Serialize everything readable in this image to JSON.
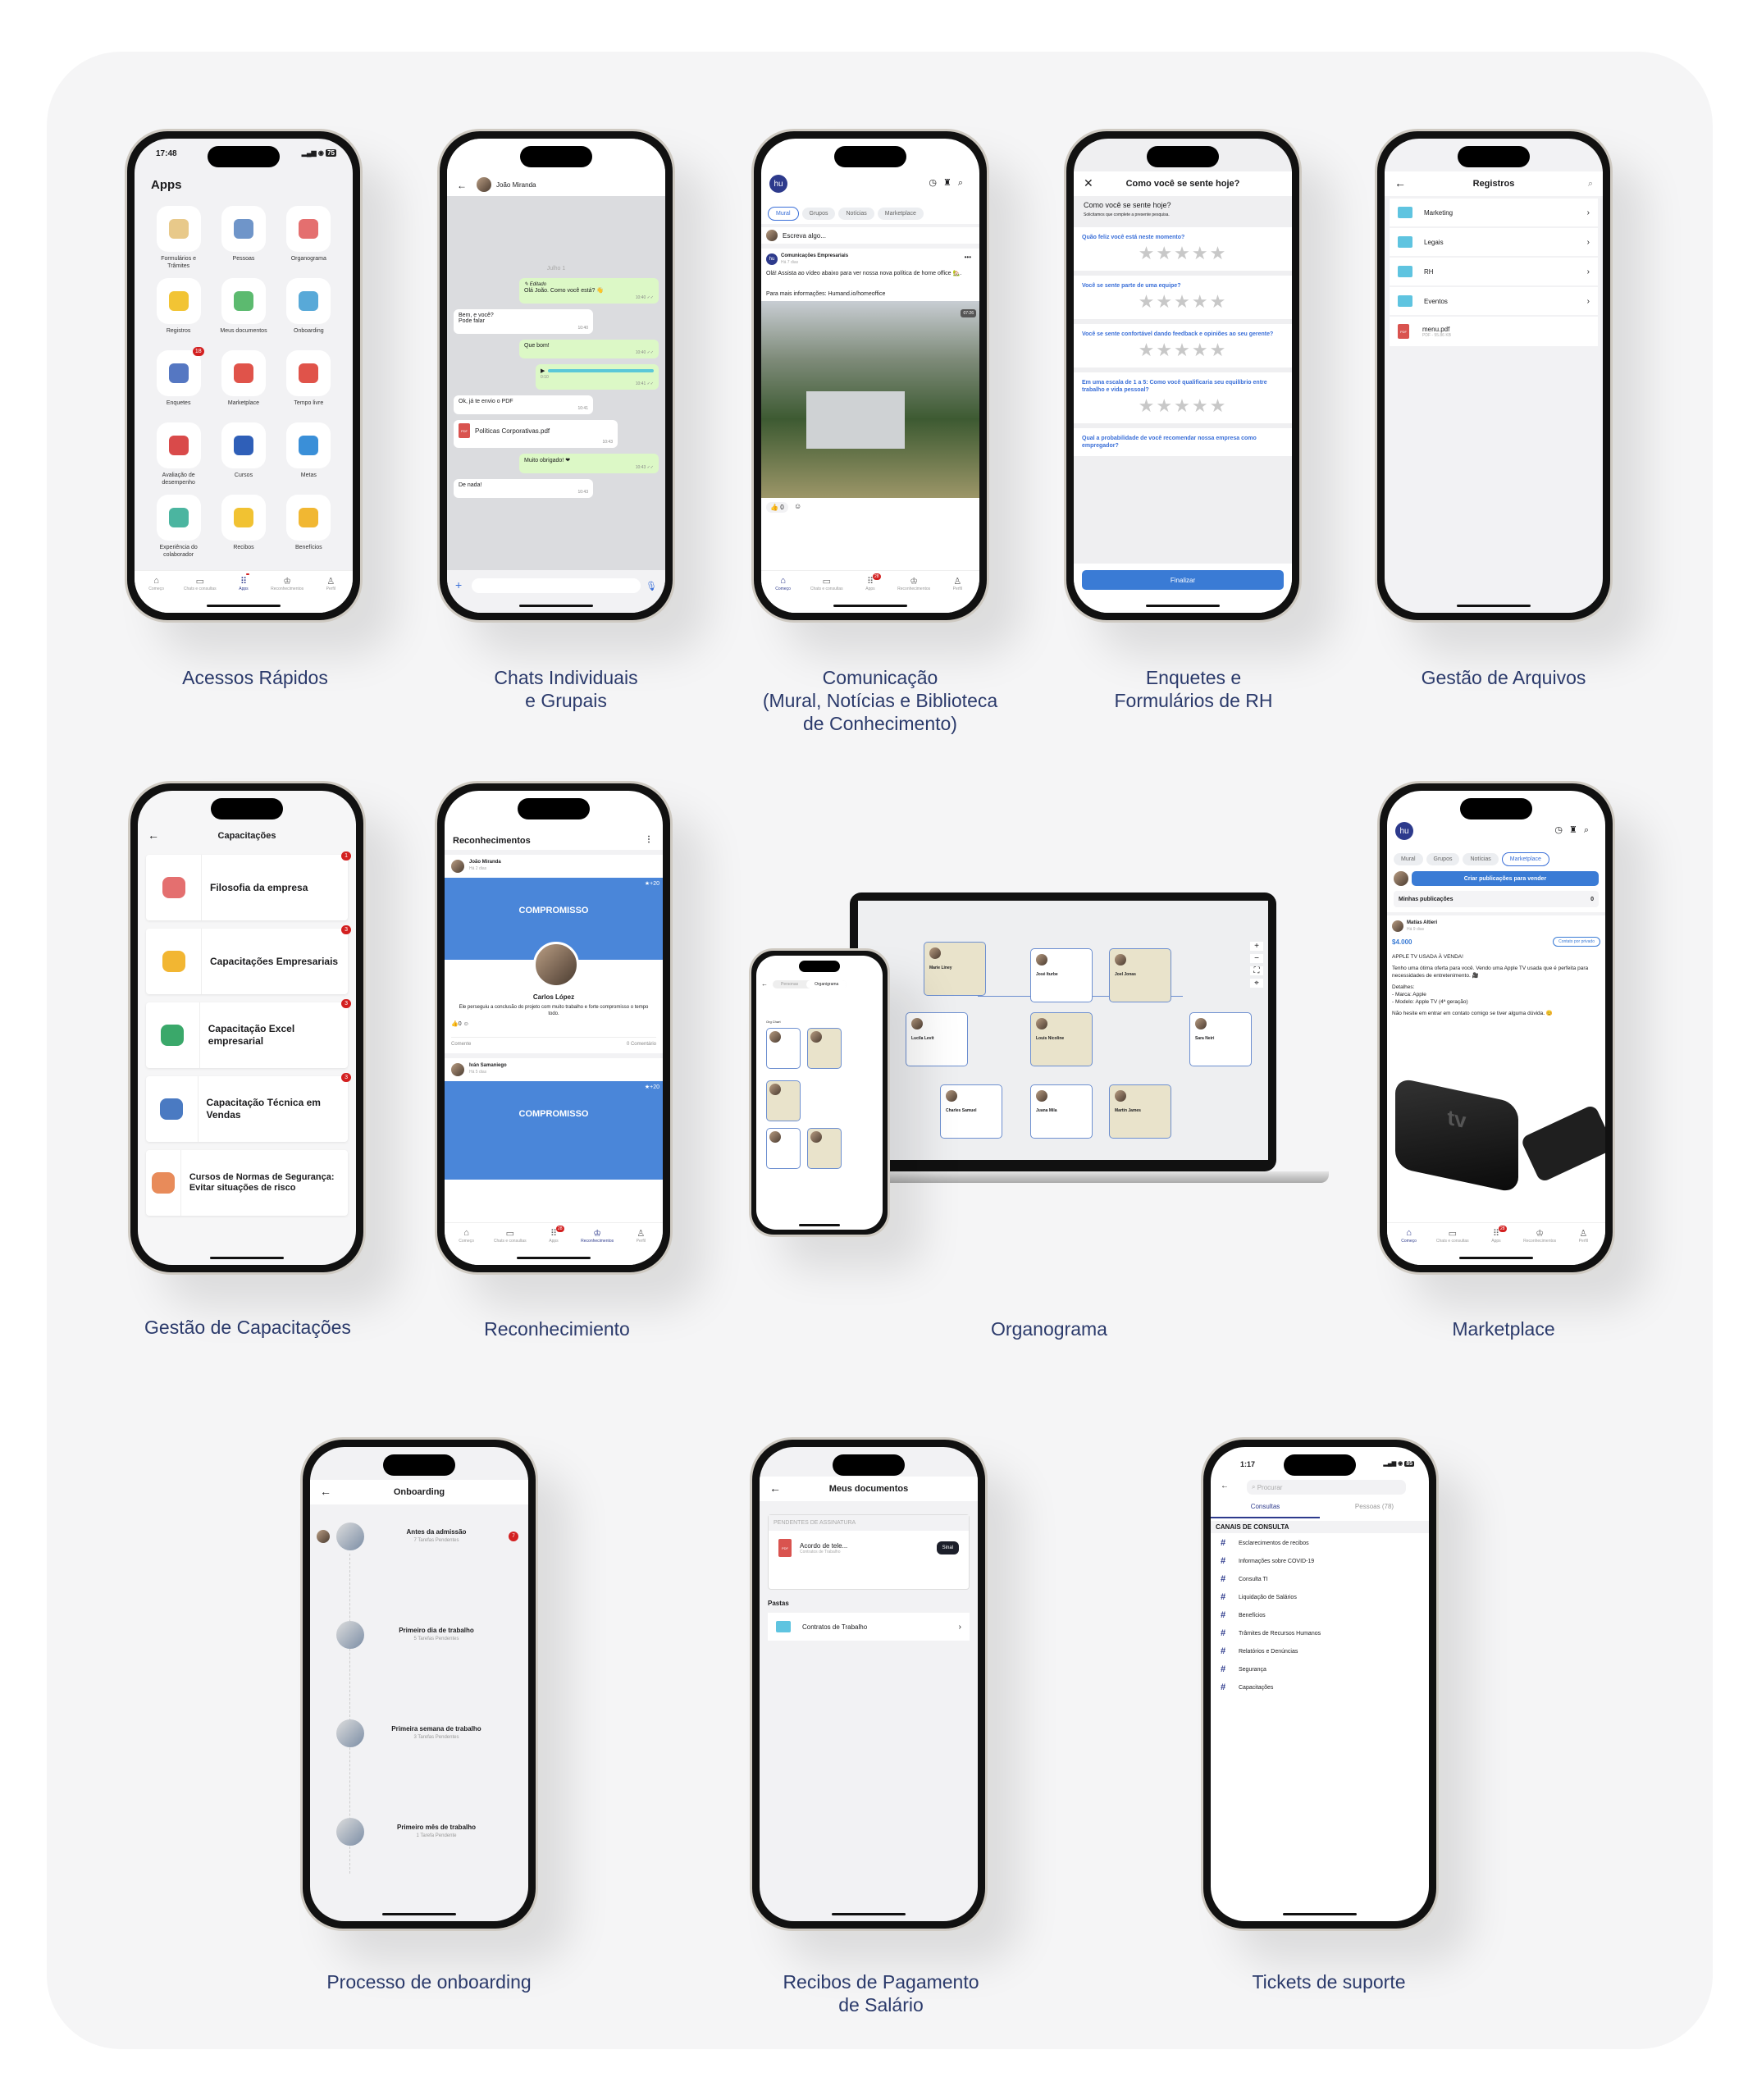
{
  "colors": {
    "accent": "#3a6fd8",
    "brand": "#2d3a8c",
    "caption": "#2b3a6b",
    "badge": "#d32020"
  },
  "nav": {
    "items": [
      "Começo",
      "Chats e consultas",
      "Apps",
      "Reconhecimentos",
      "Perfil"
    ],
    "badge_apps_phone1": "18",
    "badge": "28"
  },
  "captions": {
    "apps": "Acessos Rápidos",
    "chats": "Chats Individuais\ne Grupais",
    "mural": "Comunicação\n(Mural, Notícias e Biblioteca\nde Conhecimento)",
    "survey": "Enquetes e\nFormulários de RH",
    "files": "Gestão de Arquivos",
    "training": "Gestão de Capacitações",
    "recog": "Reconhecimiento",
    "org": "Organograma",
    "market": "Marketplace",
    "onboarding": "Processo de onboarding",
    "payslip": "Recibos de Pagamento\nde Salário",
    "tickets": "Tickets de suporte"
  },
  "apps": {
    "time": "17:48",
    "battery": "75",
    "title": "Apps",
    "tiles": [
      {
        "label": "Formulários e Trâmites",
        "color": "#e8c98a"
      },
      {
        "label": "Pessoas",
        "color": "#6f95c9"
      },
      {
        "label": "Organograma",
        "color": "#e46f6f"
      },
      {
        "label": "Registros",
        "color": "#f2c434"
      },
      {
        "label": "Meus documentos",
        "color": "#5cba6f"
      },
      {
        "label": "Onboarding",
        "color": "#58a9d8"
      },
      {
        "label": "Enquetes",
        "color": "#5577c2",
        "badge": "18"
      },
      {
        "label": "Marketplace",
        "color": "#e0534a"
      },
      {
        "label": "Tempo livre",
        "color": "#e0534a"
      },
      {
        "label": "Avaliação de desempenho",
        "color": "#d94a4a"
      },
      {
        "label": "Cursos",
        "color": "#2f5fb8"
      },
      {
        "label": "Metas",
        "color": "#3a8fd8"
      },
      {
        "label": "Experiência do colaborador",
        "color": "#4bb5a0"
      },
      {
        "label": "Recibos",
        "color": "#f1c232"
      },
      {
        "label": "Benefícios",
        "color": "#f1b732"
      }
    ]
  },
  "chat": {
    "contact": "João Miranda",
    "date": "Julho 1",
    "messages": [
      {
        "dir": "out",
        "edited": "✎ Editado",
        "text": "Olá João. Como você está? 👋",
        "time": "10:40 ✓✓"
      },
      {
        "dir": "in",
        "text": "Bem, e você?\nPode falar",
        "time": "10:40"
      },
      {
        "dir": "out",
        "text": "Que bom!",
        "time": "10:40 ✓✓"
      },
      {
        "dir": "out",
        "audio": "0:10",
        "time": "10:41 ✓✓"
      },
      {
        "dir": "in",
        "text": "Ok, já te envio o PDF",
        "time": "10:41"
      },
      {
        "dir": "in",
        "file": "Políticas Corporativas.pdf",
        "time": "10:43"
      },
      {
        "dir": "out",
        "text": "Muito obrigado! ❤",
        "time": "10:43 ✓✓"
      },
      {
        "dir": "in",
        "text": "De nada!",
        "time": "10:43"
      }
    ]
  },
  "mural": {
    "logo": "hu",
    "tabs": [
      "Mural",
      "Grupos",
      "Notícias",
      "Marketplace"
    ],
    "compose_placeholder": "Escreva algo...",
    "post": {
      "author": "Comunicações Empresariais",
      "ago": "Há 7 dias",
      "text": "Olá! Assista ao vídeo abaixo para ver nossa nova política de home office 🏡.",
      "link": "Para mais informações: Humand.io/homeoffice",
      "duration": "07:26",
      "likes": "0"
    }
  },
  "survey": {
    "title": "Como você se sente hoje?",
    "heading": "Como você se sente hoje?",
    "subtitle": "Solicitamos que complete a presente pesquisa.",
    "questions": [
      "Quão feliz você está neste momento?",
      "Você se sente parte de uma equipe?",
      "Você se sente confortável dando feedback e opiniões ao seu gerente?",
      "Em uma escala de 1 a 5: Como você qualificaria seu equilíbrio entre trabalho e vida pessoal?",
      "Qual a probabilidade de você recomendar nossa empresa como empregador?"
    ],
    "rating_max": 5,
    "submit": "Finalizar"
  },
  "files": {
    "title": "Registros",
    "folders": [
      "Marketing",
      "Legais",
      "RH",
      "Eventos"
    ],
    "file": {
      "name": "menu.pdf",
      "meta": "PDF - 55.86 KB",
      "type": "PDF"
    }
  },
  "training": {
    "title": "Capacitações",
    "items": [
      {
        "label": "Filosofia da empresa",
        "badge": "1",
        "color": "#e46f6f"
      },
      {
        "label": "Capacitações Empresariais",
        "badge": "3",
        "color": "#f2b632"
      },
      {
        "label": "Capacitação Excel empresarial",
        "badge": "3",
        "color": "#3aa86a"
      },
      {
        "label": "Capacitação Técnica em Vendas",
        "badge": "3",
        "color": "#4a7ac2"
      },
      {
        "label": "Cursos de Normas de Segurança: Evitar situações de risco",
        "color": "#e88b5a"
      }
    ]
  },
  "recog": {
    "title": "Reconhecimentos",
    "posts": [
      {
        "author": "João Miranda",
        "ago": "Há 2 dias",
        "points": "★+20",
        "value": "COMPROMISSO",
        "person": "Carlos López",
        "text": "Ele perseguiu a conclusão do projeto com muito trabalho e forte compromisso o tempo todo.",
        "likes": "0",
        "comment": "Comente",
        "comments": "0 Comentário"
      },
      {
        "author": "Iván Samaniego",
        "ago": "Há 5 dias",
        "points": "★+20",
        "value": "COMPROMISSO"
      }
    ]
  },
  "org": {
    "phone_tabs": [
      "Personas",
      "Organigrama"
    ],
    "phone_label": "Org Chart",
    "nodes": [
      {
        "name": "Marie Liney",
        "beige": true
      },
      {
        "name": "José Iturbe"
      },
      {
        "name": "Joel Jonas",
        "beige": true
      },
      {
        "name": "Lucila Levit"
      },
      {
        "name": "Louis Nicoline",
        "beige": true
      },
      {
        "name": "Sara Neiri"
      },
      {
        "name": "Charles Samuel"
      },
      {
        "name": "Juana Mila"
      },
      {
        "name": "Martin James",
        "beige": true
      }
    ]
  },
  "market": {
    "logo": "hu",
    "tabs": [
      "Mural",
      "Grupos",
      "Notícias",
      "Marketplace"
    ],
    "create": "Criar publicações para vender",
    "mine": "Minhas publicações",
    "mine_count": "0",
    "post": {
      "author": "Matías  Altieri",
      "ago": "Há 9 dias",
      "price": "$4.000",
      "contact": "Contato por privado",
      "title": "APPLE TV USADA À VENDA!",
      "body": "Tenho uma ótima oferta para você. Vendo uma Apple TV usada que é perfeita para necessidades de entretenimento. 🎥",
      "details": "Detalhes:\n- Marca: Apple\n- Modelo: Apple TV (4ª geração)",
      "closing": "Não hesite em entrar em contato comigo se tiver alguma dúvida. 😊",
      "image_label": "tv"
    }
  },
  "onboarding": {
    "title": "Onboarding",
    "steps": [
      {
        "name": "Antes da admissão",
        "tasks": "7 Tarefas Pendentes",
        "badge": "7"
      },
      {
        "name": "Primeiro dia de trabalho",
        "tasks": "5 Tarefas Pendentes"
      },
      {
        "name": "Primeira semana de trabalho",
        "tasks": "3 Tarefas Pendentes"
      },
      {
        "name": "Primeiro mês de trabalho",
        "tasks": "1 Tarefa Pendente"
      }
    ]
  },
  "docs": {
    "title": "Meus documentos",
    "pending_header": "PENDENTES DE ASSINATURA",
    "pending": {
      "name": "Acordo de tele...",
      "folder": "Contratos de Trabalho",
      "action": "Sinal"
    },
    "folders_header": "Pastas",
    "folders": [
      "Contratos de Trabalho"
    ]
  },
  "tickets": {
    "time": "1:17",
    "battery": "85",
    "search_placeholder": "Procurar",
    "tabs": [
      "Consultas",
      "Pessoas (78)"
    ],
    "section": "CANAIS DE CONSULTA",
    "channels": [
      "Esclarecimentos de recibos",
      "Informações sobre COVID-19",
      "Consulta TI",
      "Liquidação de Salários",
      "Benefícios",
      "Trâmites de Recursos Humanos",
      "Relatórios e Denúncias",
      "Segurança",
      "Capacitações"
    ]
  }
}
